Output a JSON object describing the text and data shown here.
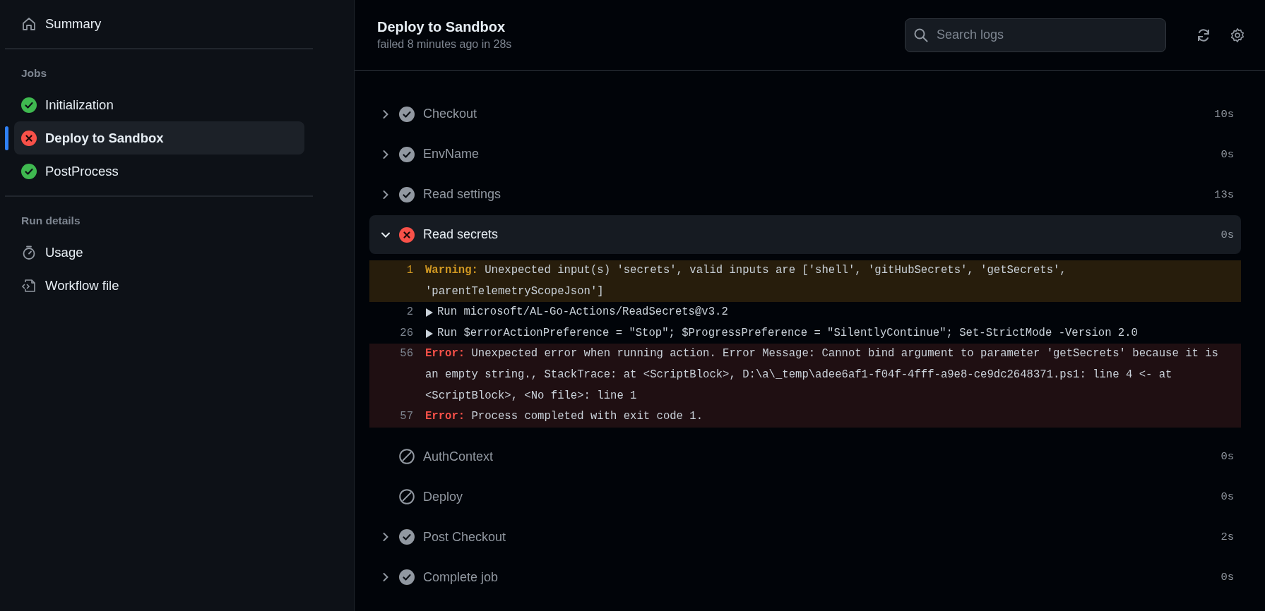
{
  "sidebar": {
    "summary": {
      "label": "Summary"
    },
    "jobs_heading": "Jobs",
    "jobs": [
      {
        "label": "Initialization",
        "kind": "success",
        "selected": false
      },
      {
        "label": "Deploy to Sandbox",
        "kind": "failure",
        "selected": true
      },
      {
        "label": "PostProcess",
        "kind": "success",
        "selected": false
      }
    ],
    "run_details_heading": "Run details",
    "run_details": [
      {
        "label": "Usage",
        "kind": "usage"
      },
      {
        "label": "Workflow file",
        "kind": "workflow"
      }
    ]
  },
  "header": {
    "title": "Deploy to Sandbox",
    "subtitle": "failed 8 minutes ago in 28s",
    "search": {
      "placeholder": "Search logs"
    }
  },
  "steps": [
    {
      "name": "Checkout",
      "kind": "success",
      "duration": "10s",
      "expandable": true,
      "expanded": false
    },
    {
      "name": "EnvName",
      "kind": "success",
      "duration": "0s",
      "expandable": true,
      "expanded": false
    },
    {
      "name": "Read settings",
      "kind": "success",
      "duration": "13s",
      "expandable": true,
      "expanded": false
    },
    {
      "name": "Read secrets",
      "kind": "failure",
      "duration": "0s",
      "expandable": true,
      "expanded": true,
      "log": [
        {
          "number": "1",
          "kind": "warning",
          "prefix": "Warning:",
          "text": "Unexpected input(s) 'secrets', valid inputs are ['shell', 'gitHubSecrets', 'getSecrets', 'parentTelemetryScopeJson']"
        },
        {
          "number": "2",
          "kind": "group",
          "text": "Run microsoft/AL-Go-Actions/ReadSecrets@v3.2"
        },
        {
          "number": "26",
          "kind": "group",
          "text": "Run $errorActionPreference = \"Stop\"; $ProgressPreference = \"SilentlyContinue\"; Set-StrictMode -Version 2.0"
        },
        {
          "number": "56",
          "kind": "error",
          "prefix": "Error:",
          "text": "Unexpected error when running action. Error Message: Cannot bind argument to parameter 'getSecrets' because it is an empty string., StackTrace: at <ScriptBlock>, D:\\a\\_temp\\adee6af1-f04f-4fff-a9e8-ce9dc2648371.ps1: line 4 <- at <ScriptBlock>, <No file>: line 1"
        },
        {
          "number": "57",
          "kind": "error",
          "prefix": "Error:",
          "text": "Process completed with exit code 1."
        }
      ]
    },
    {
      "name": "AuthContext",
      "kind": "skipped",
      "duration": "0s",
      "expandable": false,
      "expanded": false
    },
    {
      "name": "Deploy",
      "kind": "skipped",
      "duration": "0s",
      "expandable": false,
      "expanded": false
    },
    {
      "name": "Post Checkout",
      "kind": "success",
      "duration": "2s",
      "expandable": true,
      "expanded": false
    },
    {
      "name": "Complete job",
      "kind": "success",
      "duration": "0s",
      "expandable": true,
      "expanded": false
    }
  ]
}
